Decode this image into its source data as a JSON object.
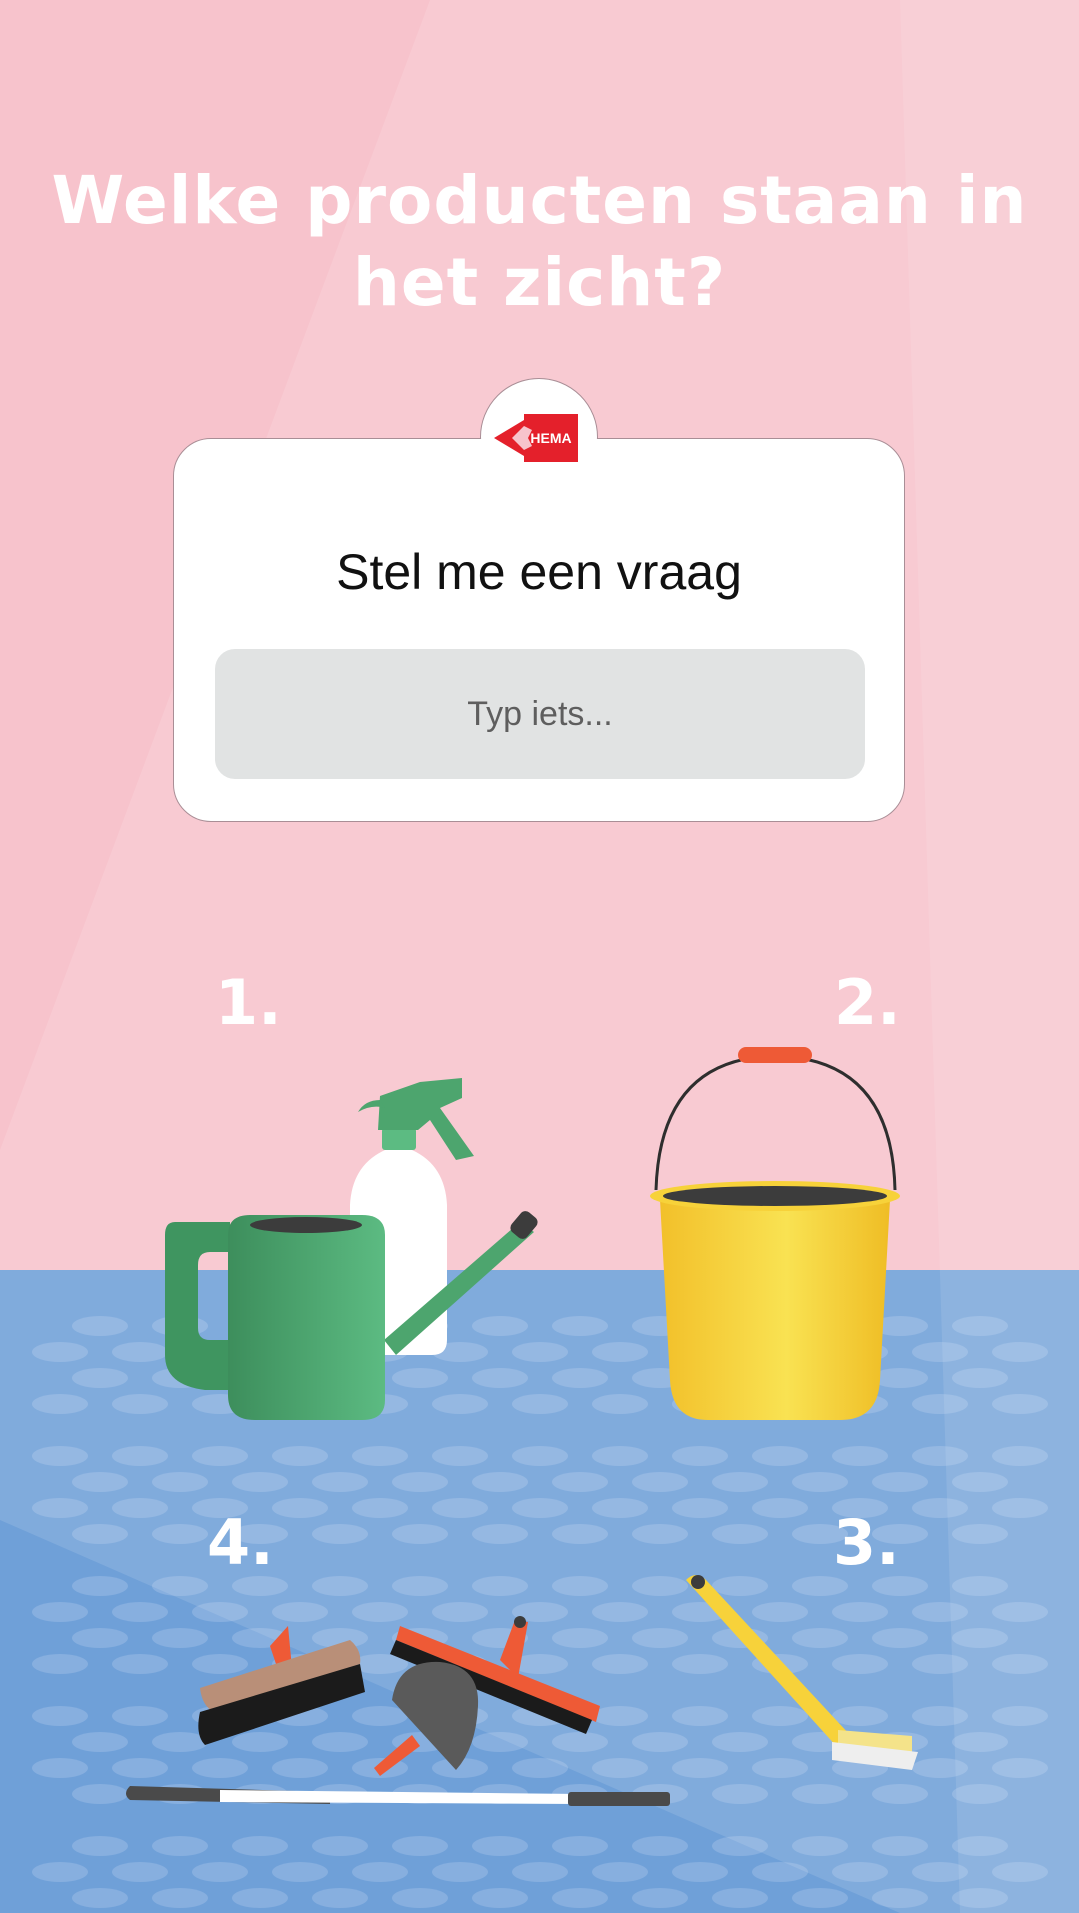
{
  "headline": "Welke producten staan in het zicht?",
  "card": {
    "logo_text": "HEMA",
    "title": "Stel me een vraag",
    "input_placeholder": "Typ iets..."
  },
  "labels": {
    "one": "1.",
    "two": "2.",
    "three": "3.",
    "four": "4."
  },
  "icons": {
    "logo": "hema-logo-icon",
    "group1": "watering-can-and-spray-bottle",
    "group2": "yellow-bucket",
    "group3": "scrub-brush",
    "group4": "cleaning-tools-set"
  },
  "colors": {
    "wall": "#f7c3cc",
    "floor": "#6fa0d8",
    "brand_red": "#e4202b",
    "bucket_yellow": "#f7d23a",
    "can_green": "#4da56e",
    "accent_orange": "#ee5a36"
  }
}
